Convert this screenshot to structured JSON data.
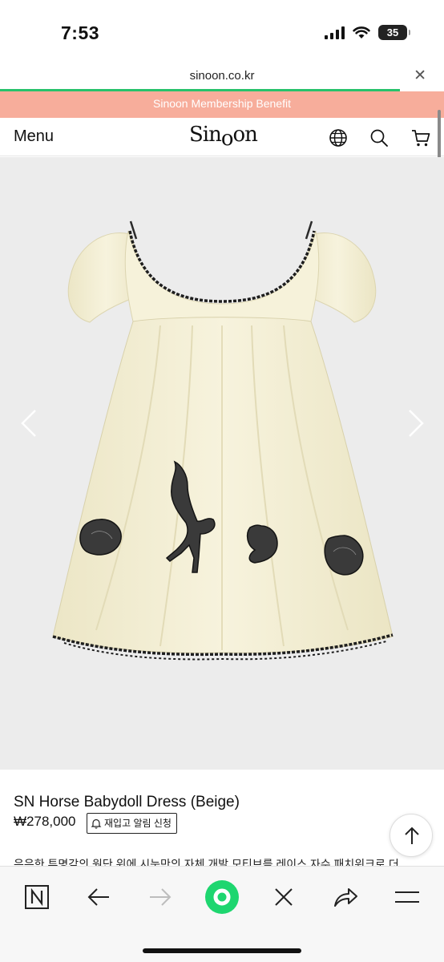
{
  "status_bar": {
    "time": "7:53",
    "battery": "35"
  },
  "browser": {
    "url": "sinoon.co.kr",
    "load_progress": 0.9
  },
  "site": {
    "banner": "Sinoon Membership Benefit",
    "menu_label": "Menu",
    "logo": {
      "part1": "Sin",
      "part2": "o",
      "part3": "on"
    },
    "header_icons": [
      "globe-icon",
      "search-icon",
      "cart-icon"
    ]
  },
  "product": {
    "image_alt": "SN Horse Babydoll Dress (Beige)",
    "name": "SN Horse Babydoll Dress (Beige)",
    "price": "₩278,000",
    "restock_label": "재입고 알림 신청",
    "description": "은은한 투명감의 원단 위에 시눈만의 자체 개발 모티브를 레이스 자수 패치워크로 더"
  },
  "colors": {
    "banner": "#f7ad9b",
    "progress": "#27c26c",
    "dress": "#f5f1d8",
    "accent_green": "#1ed66f"
  },
  "bottom_nav": [
    "naver-n-icon",
    "back-arrow-icon",
    "forward-arrow-icon",
    "green-home-icon",
    "close-icon",
    "share-icon",
    "menu-icon"
  ]
}
